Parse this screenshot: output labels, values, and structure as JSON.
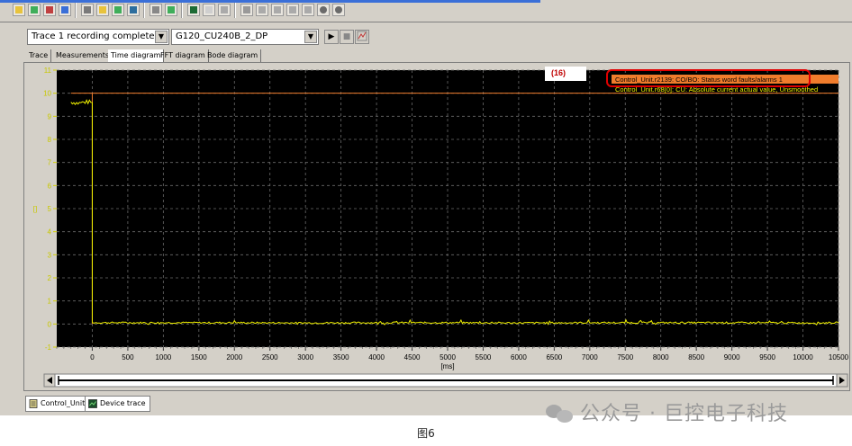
{
  "toolbar": {
    "icons": [
      "trace-config-icon",
      "signal-icon",
      "trigger-icon",
      "record-icon",
      "cursor-icon",
      "zoom-icon",
      "fit-icon",
      "measure-icon",
      "print-icon",
      "export-icon",
      "chart-icon",
      "grid-icon",
      "settings-icon",
      "snapshot-icon",
      "marker-icon",
      "compare-icon",
      "scale-icon",
      "color-icon",
      "stop-icon",
      "circle-icon"
    ]
  },
  "controls": {
    "status_combo": "Trace 1 recording completed",
    "device_combo": "G120_CU240B_2_DP",
    "play_label": "▶",
    "stop_label": "■"
  },
  "tabs": [
    {
      "label": "Trace",
      "active": false
    },
    {
      "label": "Measurements",
      "active": false
    },
    {
      "label": "Time diagram",
      "active": true
    },
    {
      "label": "FFT diagram",
      "active": false
    },
    {
      "label": "Bode diagram",
      "active": false
    }
  ],
  "annotation": {
    "label": "(16)"
  },
  "legend": [
    {
      "text": "Control_Unit.r2139: CO/BO: Status word faults/alarms 1",
      "color": "#f07c2c",
      "bg": "#f07c2c"
    },
    {
      "text": "Control_Unit.r68[0]: CU: Absolute current actual value, Unsmoothed",
      "color": "#f2f200",
      "bg": "#000000"
    }
  ],
  "chart_data": {
    "type": "line",
    "xlabel": "[ms]",
    "ylabel": "[]",
    "xlim": [
      -500,
      10500
    ],
    "ylim": [
      -1,
      11
    ],
    "x_ticks": [
      "0",
      "500",
      "1000",
      "1500",
      "2000",
      "2500",
      "3000",
      "3500",
      "4000",
      "4500",
      "5000",
      "5500",
      "6000",
      "6500",
      "7000",
      "7500",
      "8000",
      "8500",
      "9000",
      "9500",
      "10000",
      "10500"
    ],
    "y_ticks": [
      "-1",
      "0",
      "1",
      "2",
      "3",
      "4",
      "5",
      "6",
      "7",
      "8",
      "9",
      "10",
      "11"
    ],
    "grid": true,
    "series": [
      {
        "name": "Control_Unit.r2139: CO/BO: Status word faults/alarms 1",
        "color": "#f07c2c",
        "x": [
          -300,
          0,
          0,
          10500
        ],
        "y": [
          10,
          10,
          10,
          10
        ]
      },
      {
        "name": "Control_Unit.r68[0]: CU: Absolute current actual value, Unsmoothed",
        "color": "#f2f200",
        "x": [
          -300,
          -200,
          -100,
          0,
          0,
          1000,
          2000,
          3000,
          4000,
          5000,
          6000,
          7000,
          8000,
          9000,
          10000,
          10500
        ],
        "y": [
          9.6,
          9.55,
          9.6,
          9.6,
          0.05,
          0.05,
          0.05,
          0.04,
          0.05,
          0.05,
          0.04,
          0.05,
          0.05,
          0.05,
          0.04,
          0.05
        ]
      }
    ]
  },
  "statusbar": {
    "tabs": [
      {
        "label": "Control_Unit"
      },
      {
        "label": "Device trace"
      }
    ]
  },
  "watermark": {
    "text": "公众号 · 巨控电子科技"
  },
  "caption": {
    "text": "图6"
  }
}
